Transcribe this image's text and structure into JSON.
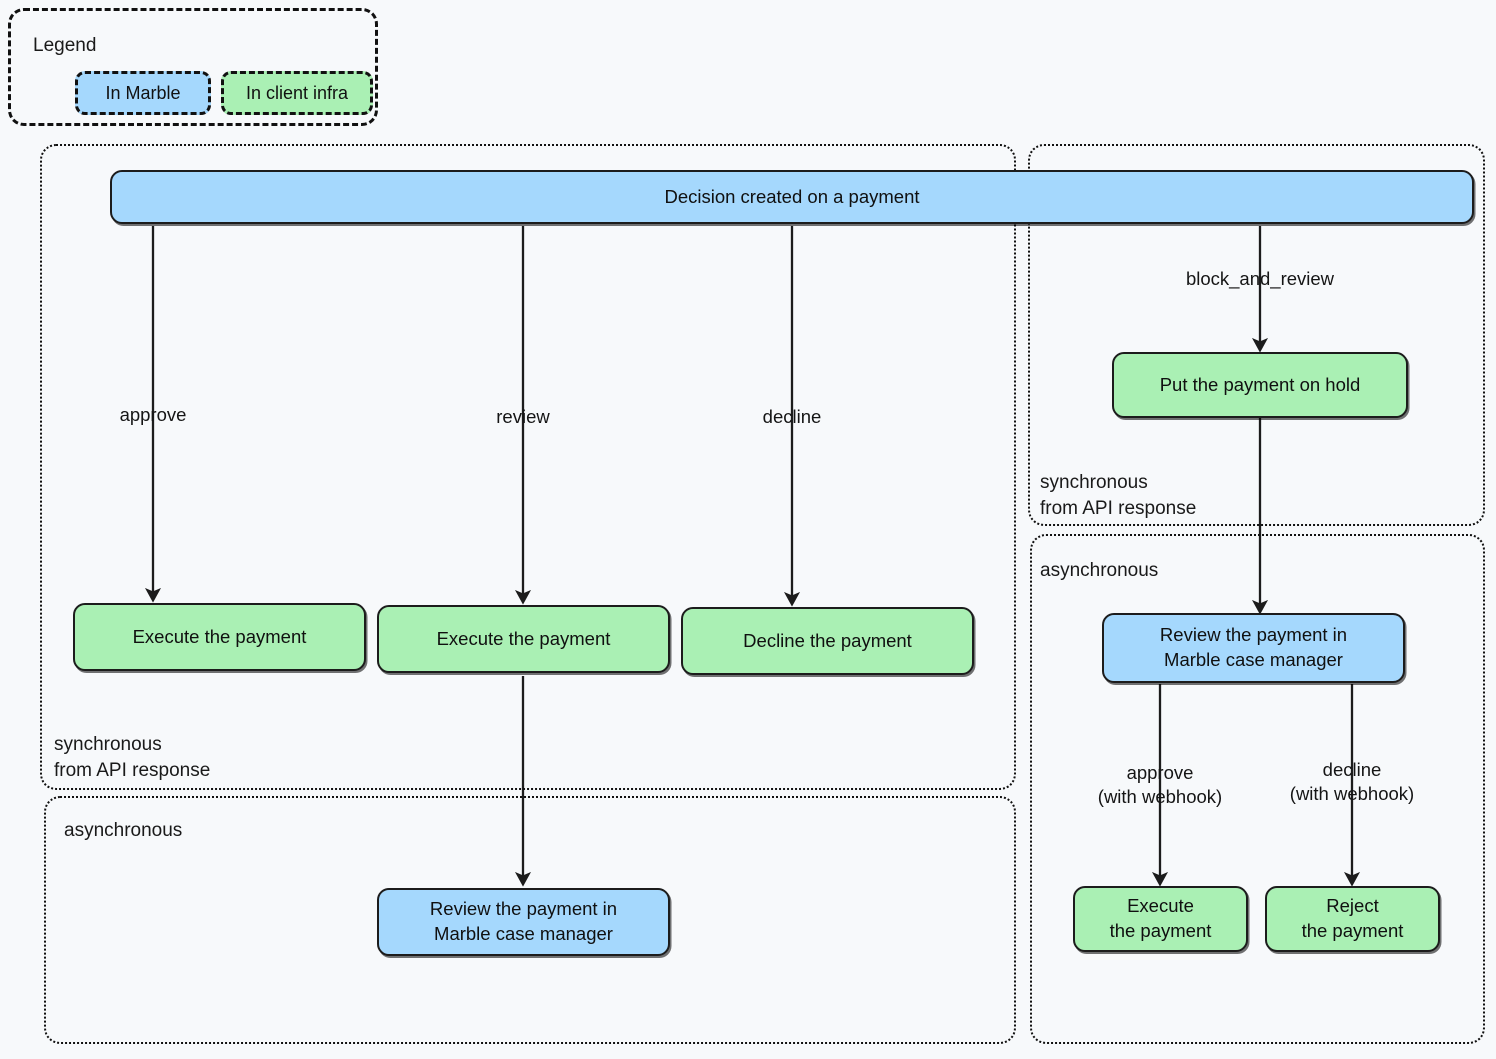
{
  "legend": {
    "title": "Legend",
    "chips": [
      {
        "label": "In Marble",
        "color": "#a5d8fd"
      },
      {
        "label": "In client infra",
        "color": "#aaf0b4"
      }
    ]
  },
  "colors": {
    "marble_fill": "#a5d8fd",
    "client_fill": "#aaf0b4",
    "background": "#f7f9fb",
    "stroke": "#1c1c1c"
  },
  "subgraphs": [
    {
      "id": "sync-left",
      "label": "synchronous\nfrom API response"
    },
    {
      "id": "async-left",
      "label": "asynchronous"
    },
    {
      "id": "sync-right",
      "label": "synchronous\nfrom API response"
    },
    {
      "id": "async-right",
      "label": "asynchronous"
    }
  ],
  "nodes": {
    "decision": {
      "label": "Decision created on a payment",
      "kind": "marble"
    },
    "execute_approve": {
      "label": "Execute the payment",
      "kind": "client"
    },
    "execute_review": {
      "label": "Execute the payment",
      "kind": "client"
    },
    "decline": {
      "label": "Decline the payment",
      "kind": "client"
    },
    "review_left": {
      "label": "Review the payment in\nMarble case manager",
      "kind": "marble"
    },
    "hold": {
      "label": "Put the payment on hold",
      "kind": "client"
    },
    "review_right": {
      "label": "Review the payment in\nMarble case manager",
      "kind": "marble"
    },
    "execute_webhook": {
      "label": "Execute\nthe payment",
      "kind": "client"
    },
    "reject_webhook": {
      "label": "Reject\nthe payment",
      "kind": "client"
    }
  },
  "edge_labels": {
    "approve": "approve",
    "review": "review",
    "decline": "decline",
    "block_and_review": "block_and_review",
    "approve_webhook": "approve\n(with webhook)",
    "decline_webhook": "decline\n(with webhook)"
  }
}
